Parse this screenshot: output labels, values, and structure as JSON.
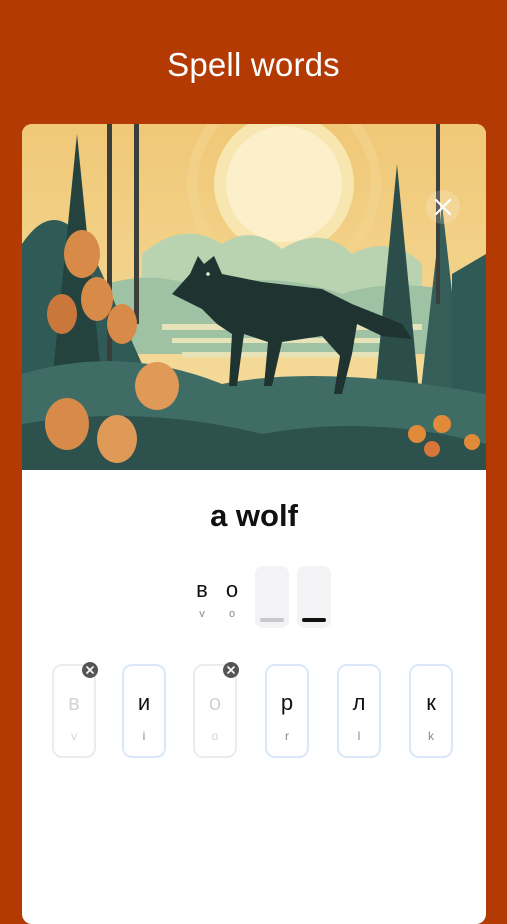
{
  "header": {
    "title": "Spell words"
  },
  "card": {
    "image_alt": "wolf in forest illustration",
    "close_icon": "close-icon",
    "word": "a wolf",
    "answer": {
      "letters": [
        {
          "char": "в",
          "latin": "v"
        },
        {
          "char": "о",
          "latin": "o"
        }
      ],
      "empty_slots": 2
    },
    "tiles": [
      {
        "char": "в",
        "latin": "v",
        "used": true
      },
      {
        "char": "и",
        "latin": "i",
        "used": false
      },
      {
        "char": "о",
        "latin": "o",
        "used": true
      },
      {
        "char": "р",
        "latin": "r",
        "used": false
      },
      {
        "char": "л",
        "latin": "l",
        "used": false
      },
      {
        "char": "к",
        "latin": "k",
        "used": false
      }
    ]
  },
  "colors": {
    "background": "#b33a03",
    "card": "#ffffff",
    "tile_border": "#dbe8f7",
    "active_slot_bar": "#111111",
    "inactive_slot_bar": "#c8c8cc"
  }
}
